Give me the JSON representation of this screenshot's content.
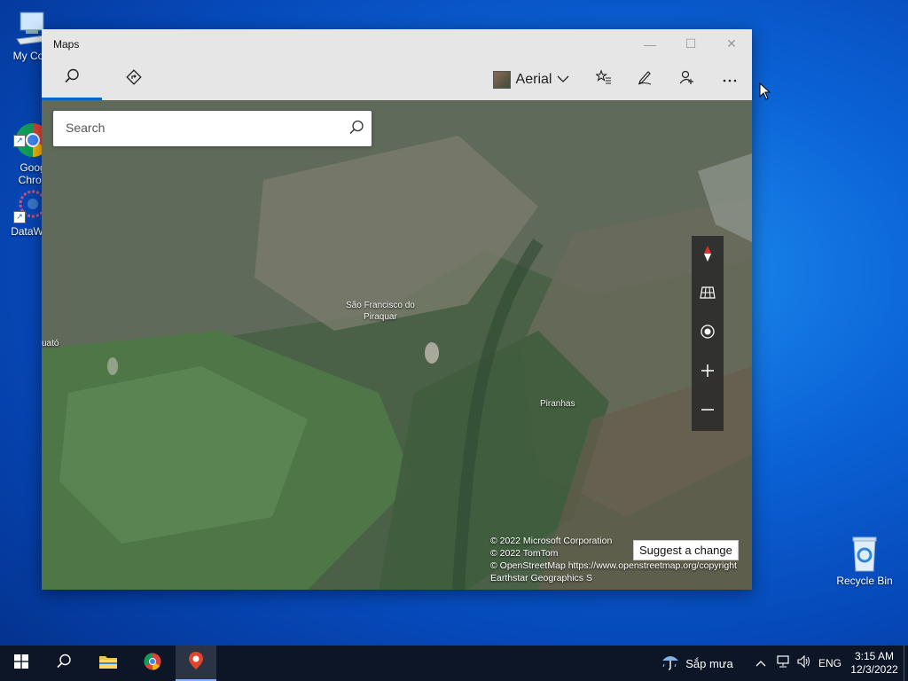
{
  "desktop": {
    "icons": [
      {
        "label": "My Com"
      },
      {
        "label": "Goog\nChron"
      },
      {
        "label": "DataWag"
      },
      {
        "label": "Recycle Bin"
      }
    ]
  },
  "window": {
    "title": "Maps",
    "controls": {
      "minimize": "—",
      "maximize": "☐",
      "close": "✕"
    }
  },
  "toolbar": {
    "map_style_label": "Aerial",
    "icons": [
      "search-icon",
      "directions-icon",
      "favorites-icon",
      "ink-icon",
      "sign-in-icon",
      "more-icon"
    ]
  },
  "search": {
    "placeholder": "Search",
    "value": ""
  },
  "map": {
    "places": [
      "São Francisco do\nPiraquar",
      "Piranhas",
      "uató"
    ],
    "attribution": [
      "© 2022 Microsoft Corporation",
      "© 2022 TomTom",
      "© OpenStreetMap https://www.openstreetmap.org/copyright",
      "Earthstar Geographics  S"
    ],
    "suggest_label": "Suggest a change",
    "controls": [
      "compass-icon",
      "map-layers-icon",
      "locate-me-icon",
      "zoom-in-icon",
      "zoom-out-icon"
    ]
  },
  "taskbar": {
    "weather": "Sắp mưa",
    "language": "ENG",
    "time": "3:15 AM",
    "date": "12/3/2022"
  }
}
